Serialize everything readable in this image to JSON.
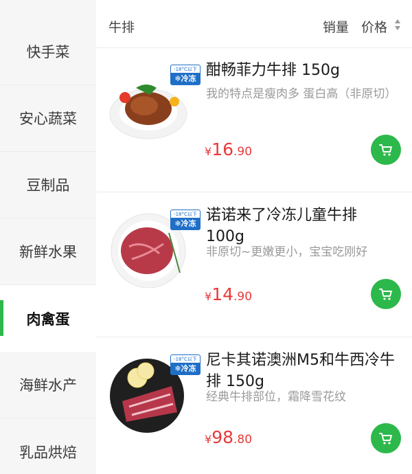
{
  "sidebar": {
    "items": [
      {
        "label": "快手菜",
        "active": false
      },
      {
        "label": "安心蔬菜",
        "active": false
      },
      {
        "label": "豆制品",
        "active": false
      },
      {
        "label": "新鲜水果",
        "active": false
      },
      {
        "label": "肉禽蛋",
        "active": true
      },
      {
        "label": "海鲜水产",
        "active": false
      },
      {
        "label": "乳品烘焙",
        "active": false
      }
    ]
  },
  "header": {
    "category_title": "牛排",
    "sort_sales_label": "销量",
    "sort_price_label": "价格",
    "sort_icon": "sort-updown-icon"
  },
  "frozen_badge": {
    "temp": "-18°C以下",
    "label": "❄冷冻"
  },
  "products": [
    {
      "name": "酣畅菲力牛排 150g",
      "description": "我的特点是瘦肉多 蛋白高（非原切）",
      "price_currency": "¥",
      "price_integer": "16",
      "price_decimal": ".90",
      "cart_icon": "cart-icon"
    },
    {
      "name": "诺诺来了冷冻儿童牛排 100g",
      "description": "非原切~更嫩更小，宝宝吃刚好",
      "price_currency": "¥",
      "price_integer": "14",
      "price_decimal": ".90",
      "cart_icon": "cart-icon"
    },
    {
      "name": "尼卡其诺澳洲M5和牛西冷牛排 150g",
      "description": "经典牛排部位，霜降雪花纹",
      "price_currency": "¥",
      "price_integer": "98",
      "price_decimal": ".80",
      "cart_icon": "cart-icon"
    }
  ],
  "colors": {
    "accent_green": "#2db84b",
    "price_red": "#e83a3a",
    "frozen_blue": "#1f6fc7",
    "sidebar_bg": "#f6f6f6"
  }
}
